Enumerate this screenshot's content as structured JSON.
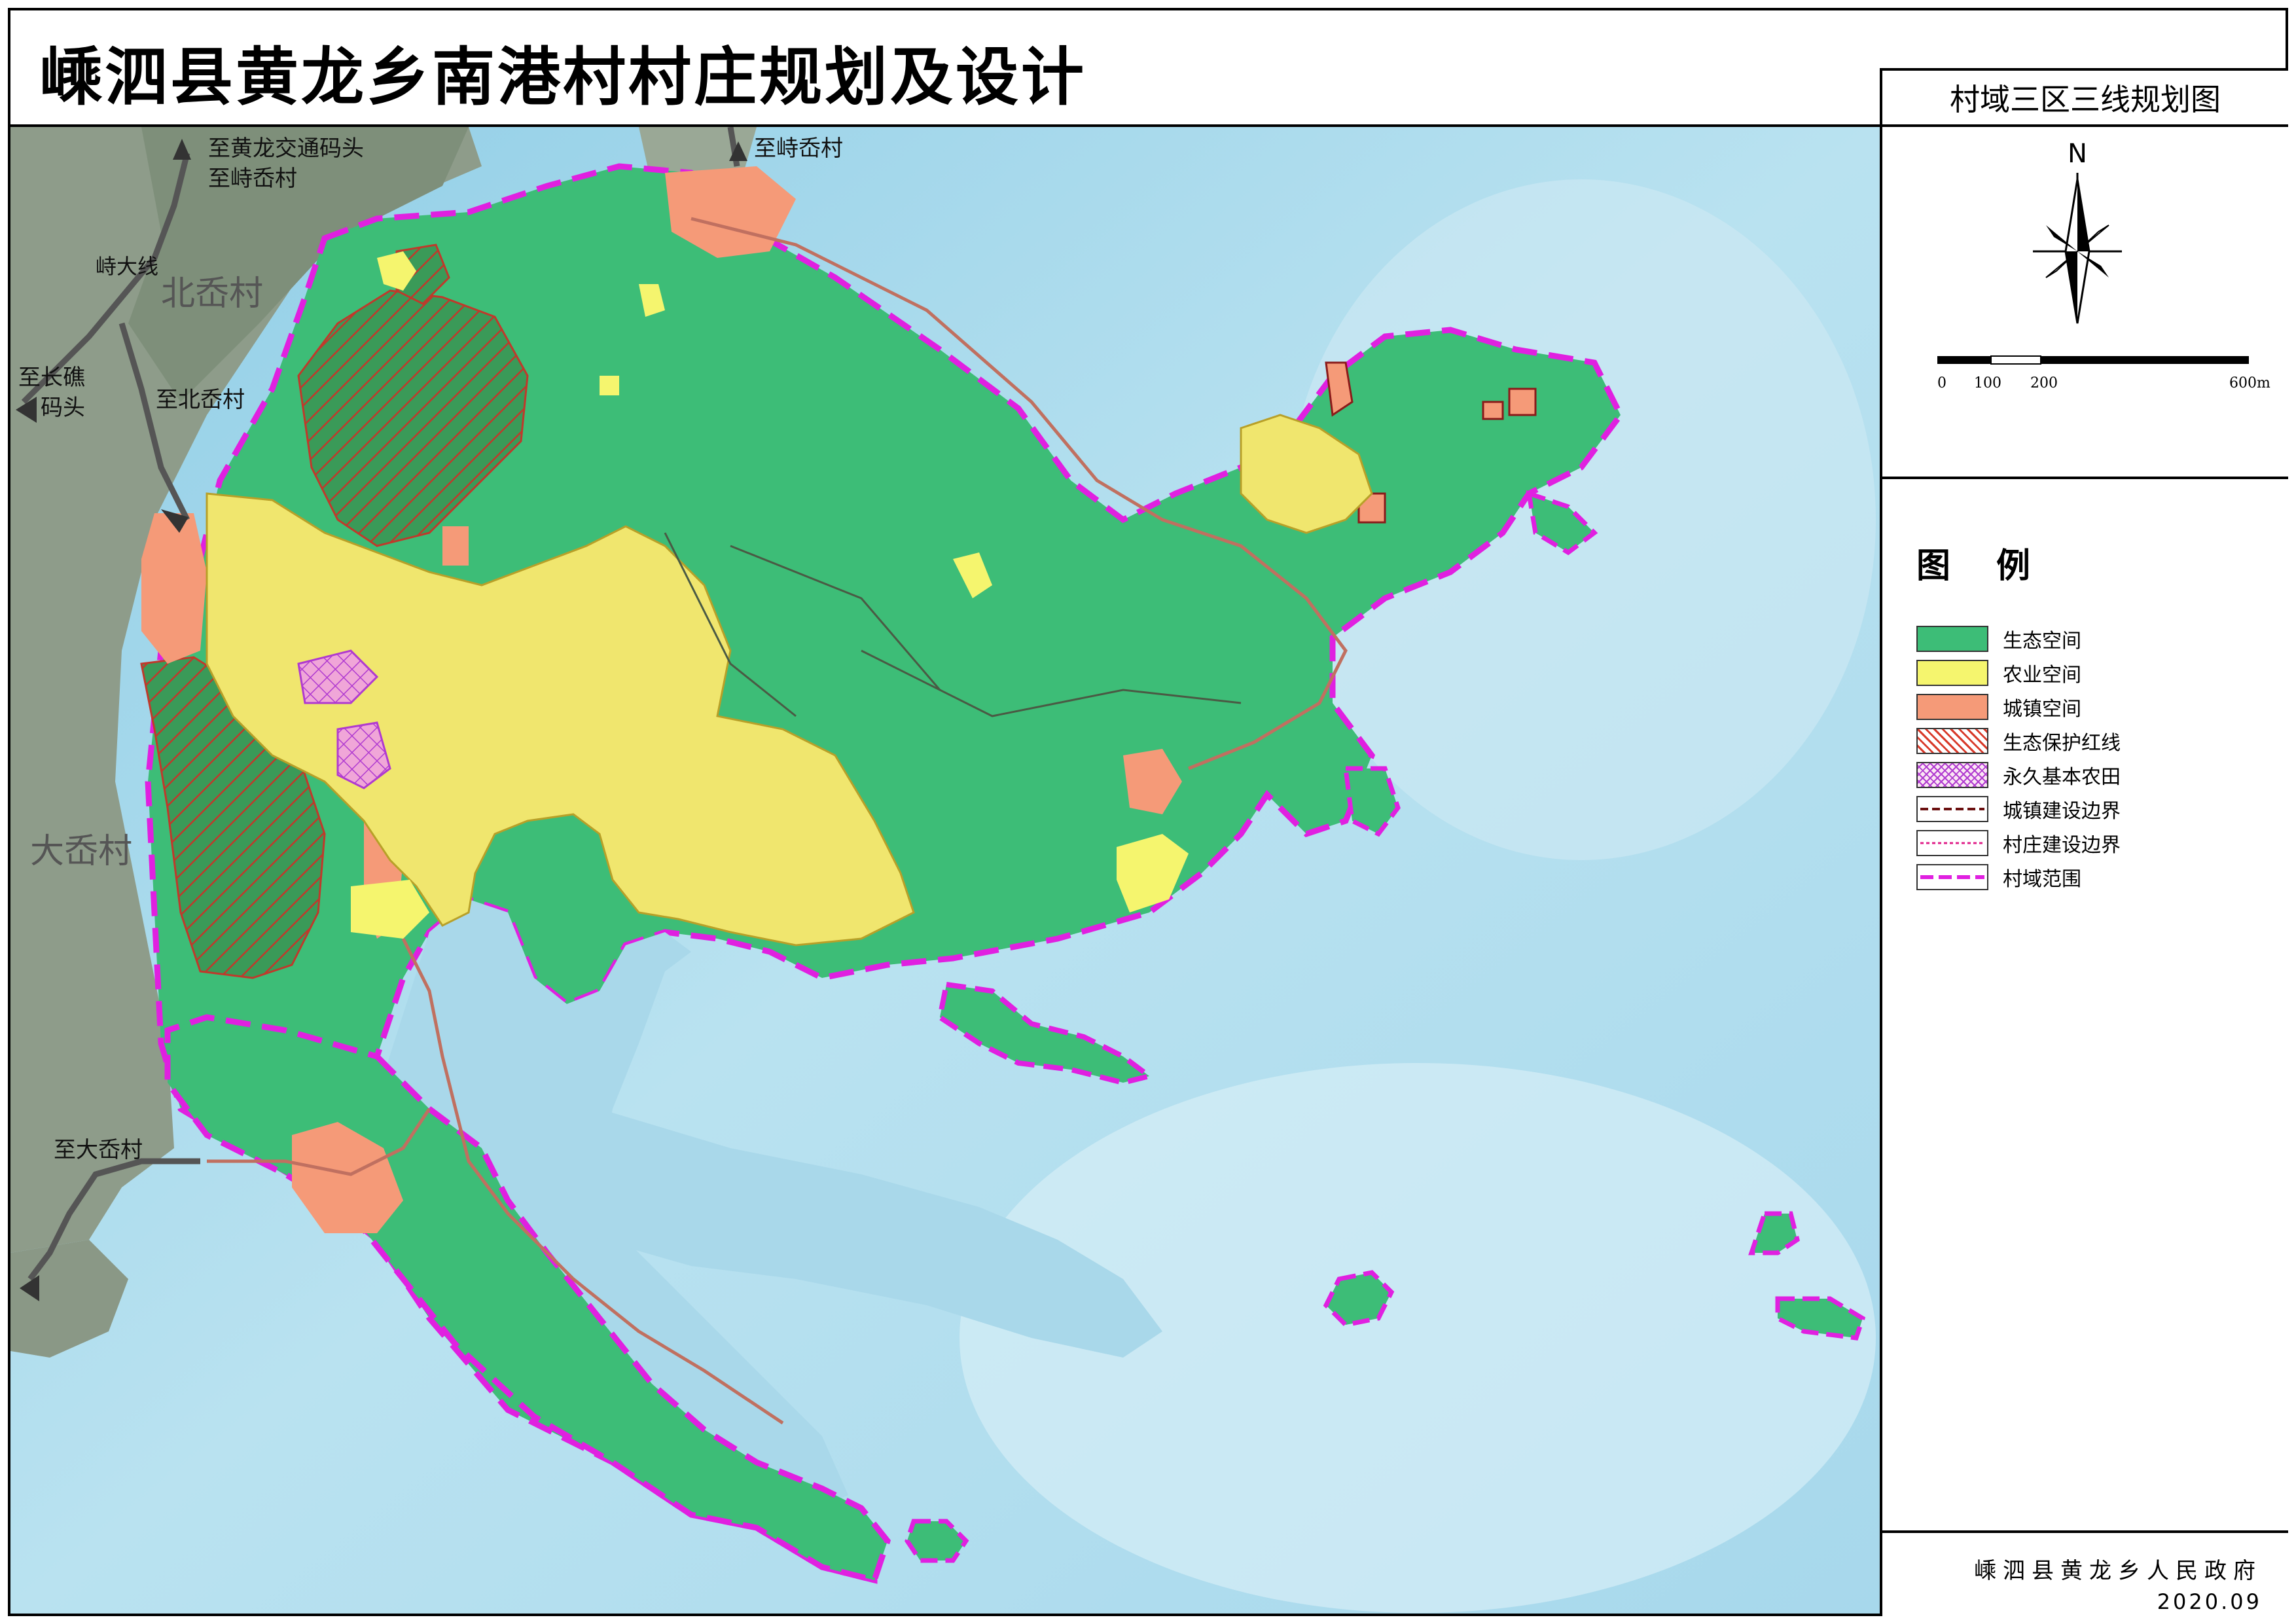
{
  "title": "嵊泗县黄龙乡南港村村庄规划及设计",
  "sheet_title": "村域三区三线规划图",
  "north_label": "N",
  "scale_bar": {
    "ticks": [
      "0",
      "100",
      "200",
      "600m"
    ]
  },
  "legend": {
    "title": "图例",
    "items": [
      {
        "label": "生态空间",
        "color": "#3dbd77",
        "style": "fill"
      },
      {
        "label": "农业空间",
        "color": "#f5f56e",
        "style": "fill"
      },
      {
        "label": "城镇空间",
        "color": "#f59a78",
        "style": "fill"
      },
      {
        "label": "生态保护红线",
        "color": "#d83a2a",
        "style": "hatch"
      },
      {
        "label": "永久基本农田",
        "color": "#b03ad0",
        "style": "crosshatch"
      },
      {
        "label": "城镇建设边界",
        "color": "#6b1010",
        "style": "dashed-line"
      },
      {
        "label": "村庄建设边界",
        "color": "#e0208a",
        "style": "dotted-line"
      },
      {
        "label": "村域范围",
        "color": "#e020e0",
        "style": "thick-dashed-line"
      }
    ]
  },
  "map_labels": {
    "to_huanglong": "至黄龙交通码头",
    "to_shidai_1": "至峙岙村",
    "to_shidai_2": "至峙岙村",
    "road_name": "峙大线",
    "beiao": "北岙村",
    "to_changqiao_1": "至长礁",
    "to_changqiao_2": "码头",
    "to_beiao": "至北岙村",
    "daao": "大岙村",
    "to_daao": "至大岙村"
  },
  "issuer": "嵊泗县黄龙乡人民政府",
  "date": "2020.09"
}
